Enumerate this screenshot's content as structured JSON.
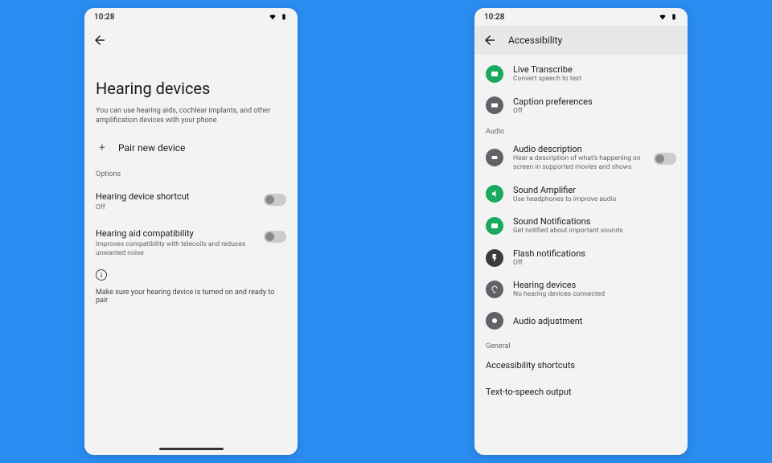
{
  "statusbar": {
    "time": "10:28"
  },
  "left": {
    "title": "Hearing devices",
    "description": "You can use hearing aids, cochlear implants, and other amplification devices with your phone",
    "pair_label": "Pair new device",
    "options_label": "Options",
    "shortcut": {
      "title": "Hearing device shortcut",
      "sub": "Off"
    },
    "compat": {
      "title": "Hearing aid compatibility",
      "sub": "Improves compatibility with telecoils and reduces unwanted noise"
    },
    "tip": "Make sure your hearing device is turned on and ready to pair"
  },
  "right": {
    "header": "Accessibility",
    "items": {
      "live_transcribe": {
        "title": "Live Transcribe",
        "sub": "Convert speech to text"
      },
      "caption": {
        "title": "Caption preferences",
        "sub": "Off"
      }
    },
    "audio_label": "Audio",
    "audio": {
      "desc": {
        "title": "Audio description",
        "sub": "Hear a description of what's happening on screen in supported movies and shows"
      },
      "amplifier": {
        "title": "Sound Amplifier",
        "sub": "Use headphones to improve audio"
      },
      "notif": {
        "title": "Sound Notifications",
        "sub": "Get notified about important sounds"
      },
      "flash": {
        "title": "Flash notifications",
        "sub": "Off"
      },
      "hearing": {
        "title": "Hearing devices",
        "sub": "No hearing devices connected"
      },
      "adjust": {
        "title": "Audio adjustment"
      }
    },
    "general_label": "General",
    "general": {
      "shortcuts": "Accessibility shortcuts",
      "tts": "Text-to-speech output"
    }
  }
}
